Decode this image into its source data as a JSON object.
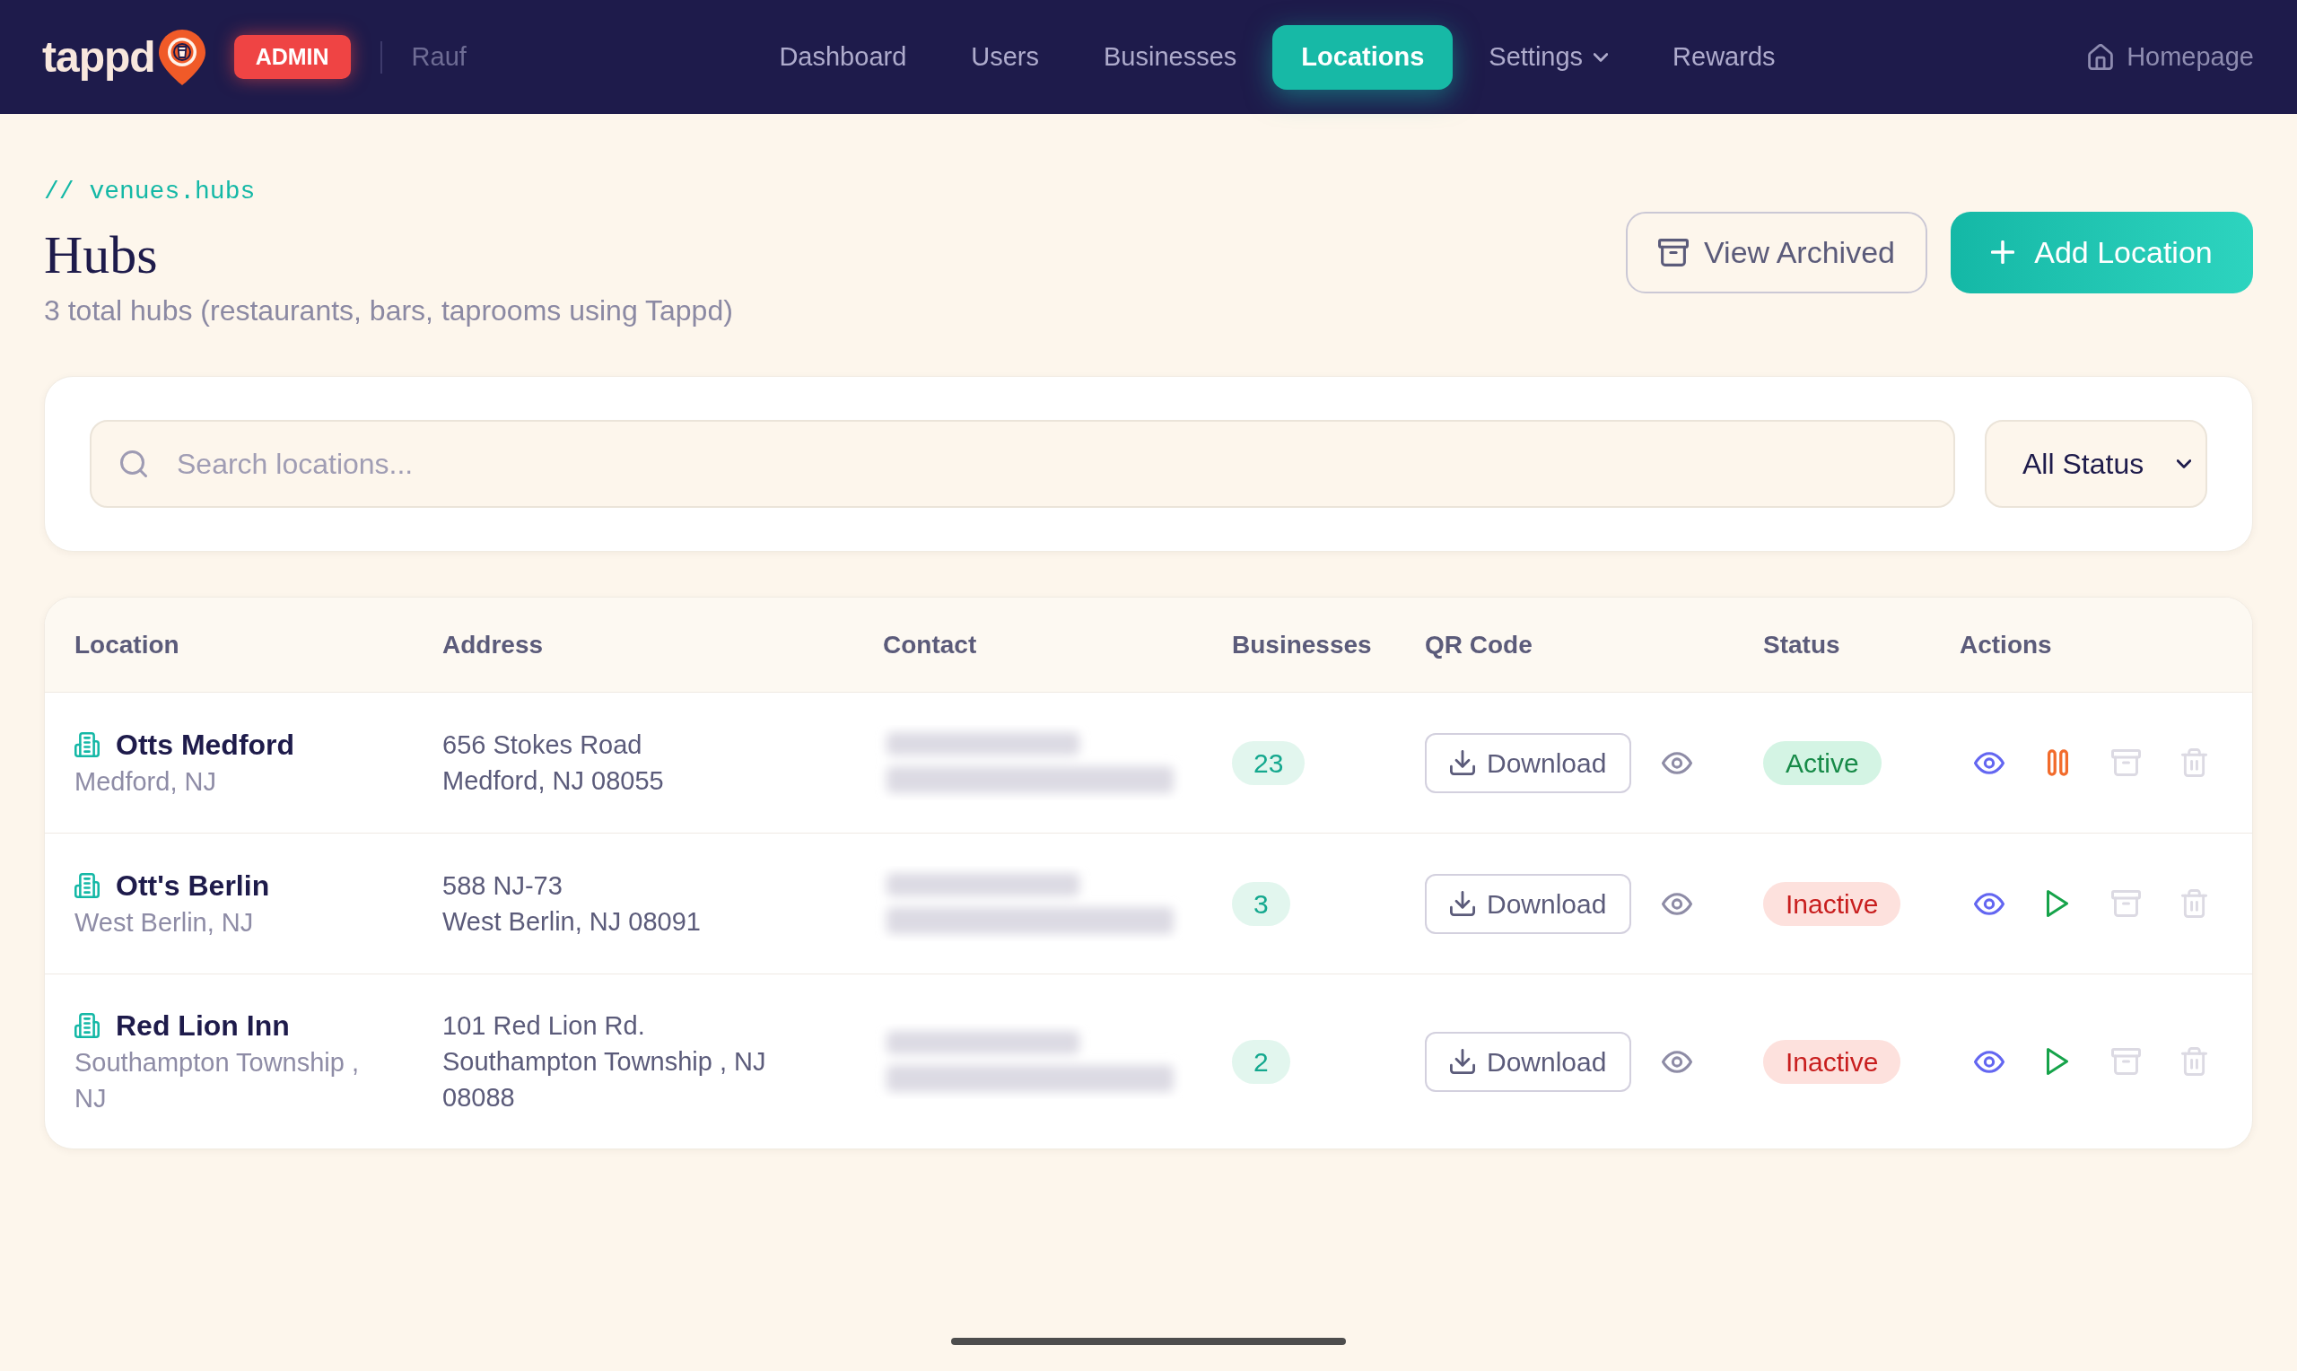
{
  "nav": {
    "brand": "tappd",
    "role_badge": "ADMIN",
    "user": "Rauf",
    "items": [
      {
        "label": "Dashboard",
        "kind": "link",
        "selected": false
      },
      {
        "label": "Users",
        "kind": "link",
        "selected": false
      },
      {
        "label": "Businesses",
        "kind": "link",
        "selected": false
      },
      {
        "label": "Locations",
        "kind": "link",
        "selected": true
      },
      {
        "label": "Settings",
        "kind": "menu",
        "selected": false
      },
      {
        "label": "Rewards",
        "kind": "link",
        "selected": false
      }
    ],
    "home_link": "Homepage"
  },
  "page": {
    "breadcrumb": "// venues.hubs",
    "title": "Hubs",
    "subtitle": "3 total hubs (restaurants, bars, taprooms using Tappd)",
    "buttons": [
      {
        "label": "View Archived",
        "kind": "secondary"
      },
      {
        "label": "Add Location",
        "kind": "primary"
      }
    ]
  },
  "filters": {
    "search": {
      "placeholder": "Search locations..."
    },
    "status_select": {
      "value": "All Status"
    }
  },
  "table": {
    "columns": [
      "Location",
      "Address",
      "Contact",
      "Businesses",
      "QR Code",
      "Status",
      "Actions"
    ],
    "rows": [
      {
        "name": "Otts Medford",
        "city": "Medford, NJ",
        "address": [
          "656 Stokes Road",
          "Medford, NJ 08055"
        ],
        "contact_blurred": true,
        "businesses": "23",
        "qr_button": "Download",
        "status": {
          "label": "Active",
          "kind": "active"
        },
        "actions": [
          {
            "kind": "view",
            "disabled": false
          },
          {
            "kind": "pause",
            "disabled": false
          },
          {
            "kind": "archive",
            "disabled": true
          },
          {
            "kind": "delete",
            "disabled": true
          }
        ]
      },
      {
        "name": "Ott's Berlin",
        "city": "West Berlin, NJ",
        "address": [
          "588 NJ-73",
          "West Berlin, NJ 08091"
        ],
        "contact_blurred": true,
        "businesses": "3",
        "qr_button": "Download",
        "status": {
          "label": "Inactive",
          "kind": "inactive"
        },
        "actions": [
          {
            "kind": "view",
            "disabled": false
          },
          {
            "kind": "play",
            "disabled": false
          },
          {
            "kind": "archive",
            "disabled": true
          },
          {
            "kind": "delete",
            "disabled": true
          }
        ]
      },
      {
        "name": "Red Lion Inn",
        "city": "Southampton Township , NJ",
        "address": [
          "101 Red Lion Rd.",
          "Southampton Township , NJ 08088"
        ],
        "contact_blurred": true,
        "businesses": "2",
        "qr_button": "Download",
        "status": {
          "label": "Inactive",
          "kind": "inactive"
        },
        "actions": [
          {
            "kind": "view",
            "disabled": false
          },
          {
            "kind": "play",
            "disabled": false
          },
          {
            "kind": "archive",
            "disabled": true
          },
          {
            "kind": "delete",
            "disabled": true
          }
        ]
      }
    ]
  }
}
